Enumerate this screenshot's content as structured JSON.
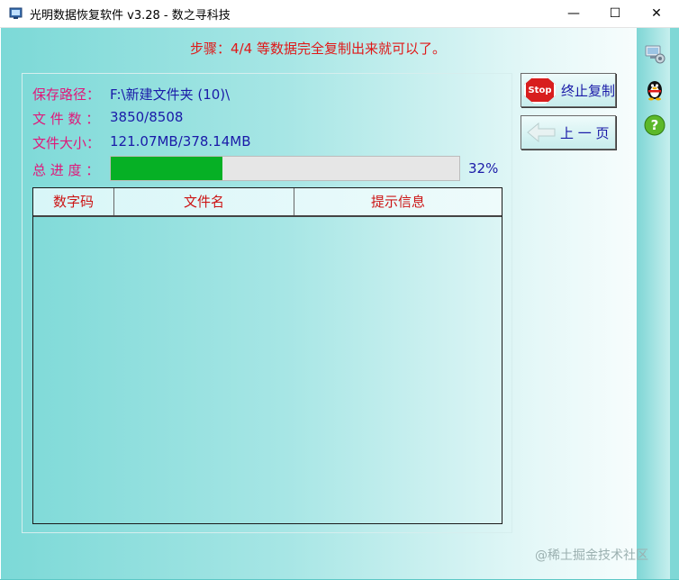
{
  "window": {
    "title": "光明数据恢复软件 v3.28 - 数之寻科技",
    "minimize_glyph": "—",
    "maximize_glyph": "☐",
    "close_glyph": "✕"
  },
  "step": {
    "text": "步骤：4/4 等数据完全复制出来就可以了。"
  },
  "info": {
    "save_path_label": "保存路径：",
    "save_path_value": "F:\\新建文件夹 (10)\\",
    "file_count_label": "文 件 数 ：",
    "file_count_value": "3850/8508",
    "file_size_label": "文件大小：",
    "file_size_value": "121.07MB/378.14MB",
    "progress_label": "总 进 度 ：",
    "progress_text": "32%",
    "progress_value": 0.32
  },
  "table": {
    "columns": [
      "数字码",
      "文件名",
      "提示信息"
    ],
    "rows": []
  },
  "buttons": {
    "stop_label": "终止复制",
    "stop_icon_text": "Stop",
    "prev_label": "上 一 页"
  },
  "side_icons": [
    "network-settings-icon",
    "qq-penguin-icon",
    "help-icon"
  ],
  "watermark": "@稀土掘金技术社区",
  "colors": {
    "step_text": "#e01818",
    "label": "#e0187a",
    "value": "#1a1aa8",
    "progress_fill": "#06b025",
    "header_text": "#cc1414"
  }
}
